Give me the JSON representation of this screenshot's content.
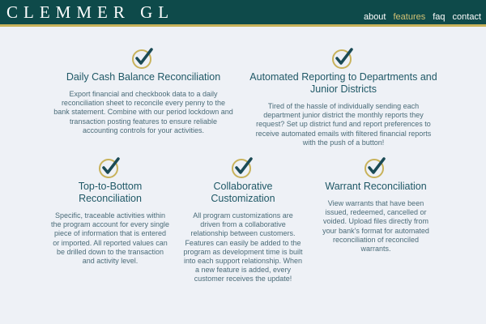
{
  "brand": {
    "name": "CLEMMER GL"
  },
  "nav": {
    "items": [
      {
        "label": "about",
        "active": false
      },
      {
        "label": "features",
        "active": true
      },
      {
        "label": "faq",
        "active": false
      },
      {
        "label": "contact",
        "active": false
      }
    ]
  },
  "colors": {
    "header_bg": "#0e4a4a",
    "header_accent": "#c8b25a",
    "active_link": "#d3c274",
    "page_bg": "#eef1f6",
    "check_color": "#1a4a55",
    "circle_color": "#c8b25a"
  },
  "features": [
    {
      "icon": "check-circle-icon",
      "title": "Daily Cash Balance Reconciliation",
      "description": "Export financial and checkbook data to a daily reconciliation sheet to reconcile every penny to the bank statement. Combine with our period lockdown and transaction posting features to ensure reliable accounting controls for your activities."
    },
    {
      "icon": "check-circle-icon",
      "title": "Automated Reporting to Departments and Junior Districts",
      "description": "Tired of the hassle of individually sending each department junior district the monthly reports they request? Set up district fund and report preferences to receive automated emails with filtered financial reports with the push of a button!"
    },
    {
      "icon": "check-circle-icon",
      "title": "Top-to-Bottom Reconciliation",
      "description": "Specific, traceable activities within the program account for every single piece of information that is entered or imported. All reported values can be drilled down to the transaction and activity level."
    },
    {
      "icon": "check-circle-icon",
      "title": "Collaborative Customization",
      "description": "All program customizations are driven from a collaborative relationship between customers. Features can easily be added to the program as development time is built into each support relationship. When a new feature is added, every customer receives the update!"
    },
    {
      "icon": "check-circle-icon",
      "title": "Warrant Reconciliation",
      "description": "View warrants that have been issued, redeemed, cancelled or voided. Upload files directly from your bank's format for automated reconciliation of reconciled warrants."
    }
  ]
}
